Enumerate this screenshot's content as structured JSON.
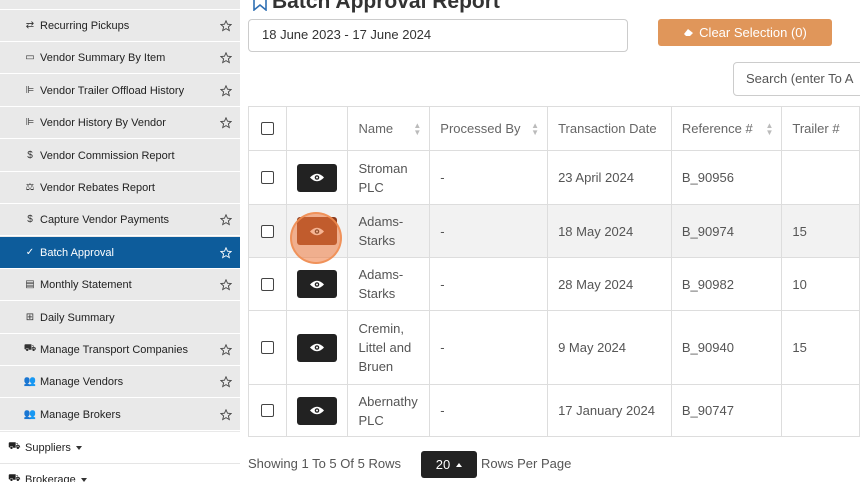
{
  "sidebar": {
    "items": [
      {
        "label": "Recurring Pickups",
        "icon": "sync-icon",
        "glyph": "⇄",
        "starred": true
      },
      {
        "label": "Vendor Summary By Item",
        "icon": "box-icon",
        "glyph": "▭",
        "starred": true
      },
      {
        "label": "Vendor Trailer Offload History",
        "icon": "chart-icon",
        "glyph": "⊫",
        "starred": true
      },
      {
        "label": "Vendor History By Vendor",
        "icon": "chart-icon",
        "glyph": "⊫",
        "starred": true
      },
      {
        "label": "Vendor Commission Report",
        "icon": "dollar-icon",
        "glyph": "$",
        "starred": false
      },
      {
        "label": "Vendor Rebates Report",
        "icon": "balance-icon",
        "glyph": "⚖",
        "starred": false
      },
      {
        "label": "Capture Vendor Payments",
        "icon": "dollar-icon",
        "glyph": "$",
        "starred": true
      },
      {
        "label": "Batch Approval",
        "icon": "check-icon",
        "glyph": "✓",
        "starred": true,
        "active": true
      },
      {
        "label": "Monthly Statement",
        "icon": "list-icon",
        "glyph": "▤",
        "starred": true
      },
      {
        "label": "Daily Summary",
        "icon": "table-icon",
        "glyph": "⊞",
        "starred": false
      },
      {
        "label": "Manage Transport Companies",
        "icon": "truck-icon",
        "glyph": "⛟",
        "starred": true
      },
      {
        "label": "Manage Vendors",
        "icon": "users-icon",
        "glyph": "👥",
        "starred": true
      },
      {
        "label": "Manage Brokers",
        "icon": "users-icon",
        "glyph": "👥",
        "starred": true
      }
    ],
    "groups": [
      {
        "label": "Suppliers",
        "icon": "truck-loading-icon",
        "glyph": "⛟"
      },
      {
        "label": "Brokerage",
        "icon": "truck-loading-icon",
        "glyph": "⛟"
      }
    ]
  },
  "page": {
    "title": "Batch Approval Report",
    "date_range": "18 June 2023 - 17 June 2024",
    "clear_button": "Clear Selection (0)",
    "search_placeholder": "Search (enter To A"
  },
  "table": {
    "headers": [
      "Name",
      "Processed By",
      "Transaction Date",
      "Reference #",
      "Trailer #"
    ],
    "rows": [
      {
        "name": "Stroman PLC",
        "processed_by": "-",
        "date": "23 April 2024",
        "ref": "B_90956",
        "trailer": ""
      },
      {
        "name": "Adams-Starks",
        "processed_by": "-",
        "date": "18 May 2024",
        "ref": "B_90974",
        "trailer": "15"
      },
      {
        "name": "Adams-Starks",
        "processed_by": "-",
        "date": "28 May 2024",
        "ref": "B_90982",
        "trailer": "10"
      },
      {
        "name": "Cremin, Littel and Bruen",
        "processed_by": "-",
        "date": "9 May 2024",
        "ref": "B_90940",
        "trailer": "15"
      },
      {
        "name": "Abernathy PLC",
        "processed_by": "-",
        "date": "17 January 2024",
        "ref": "B_90747",
        "trailer": ""
      }
    ]
  },
  "footer": {
    "showing": "Showing 1 To 5 Of 5 Rows",
    "rows_per_page_value": "20",
    "rows_per_page_label": "Rows Per Page"
  },
  "colors": {
    "active_nav": "#0d5c9b",
    "clear_button": "#e0965a",
    "eye_button": "#222222",
    "click_highlight": "#ee783c"
  }
}
